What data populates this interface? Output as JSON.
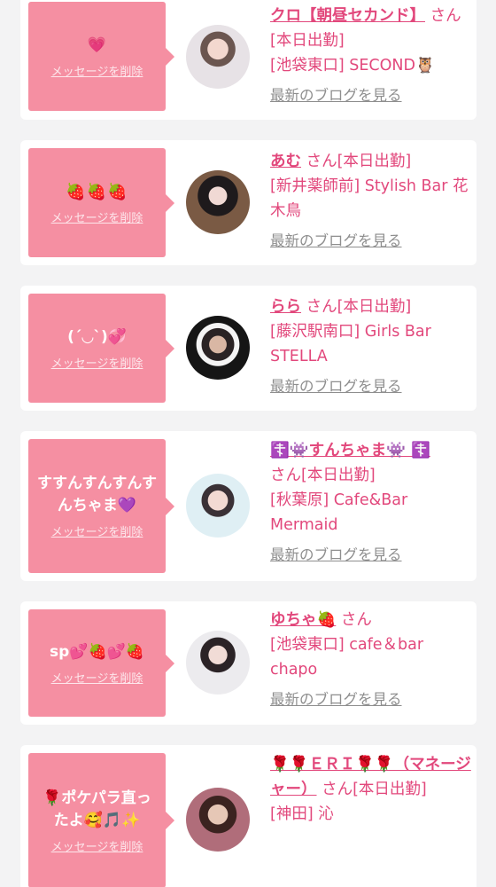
{
  "colors": {
    "accent": "#e2487c",
    "bubble": "#f58fa2",
    "link_gray": "#8e8e8e"
  },
  "delete_label": "メッセージを削除",
  "blog_label": "最新のブログを見る",
  "cards": [
    {
      "message": "💗",
      "name": "クロ【朝昼セカンド】",
      "suffix": " さん[本日出勤]",
      "shop": "[池袋東口] SECOND🦉"
    },
    {
      "message": "🍓🍓🍓",
      "name": "あむ",
      "suffix": " さん[本日出勤]",
      "shop": "[新井薬師前] Stylish Bar 花木鳥"
    },
    {
      "message": "(´◡`)💞",
      "name": "らら",
      "suffix": " さん[本日出勤]",
      "shop": "[藤沢駅南口] Girls Bar STELLA"
    },
    {
      "message": "すすんすんすんすんちゃま💜",
      "name": "☦️👾すんちゃま👾 ☦️",
      "suffix": " さん[本日出勤]",
      "shop": "[秋葉原] Cafe&Bar Mermaid"
    },
    {
      "message": "sp💕🍓💕🍓",
      "name": "ゆちゃ🍓",
      "suffix": " さん",
      "shop": "[池袋東口] cafe＆bar chapo"
    },
    {
      "message": "🌹ポケパラ直ったよ🥰🎵✨",
      "name": "🌹🌹ＥＲＩ🌹🌹（マネージャー）",
      "suffix": " さん[本日出勤]",
      "shop": "[神田] 沁"
    }
  ]
}
